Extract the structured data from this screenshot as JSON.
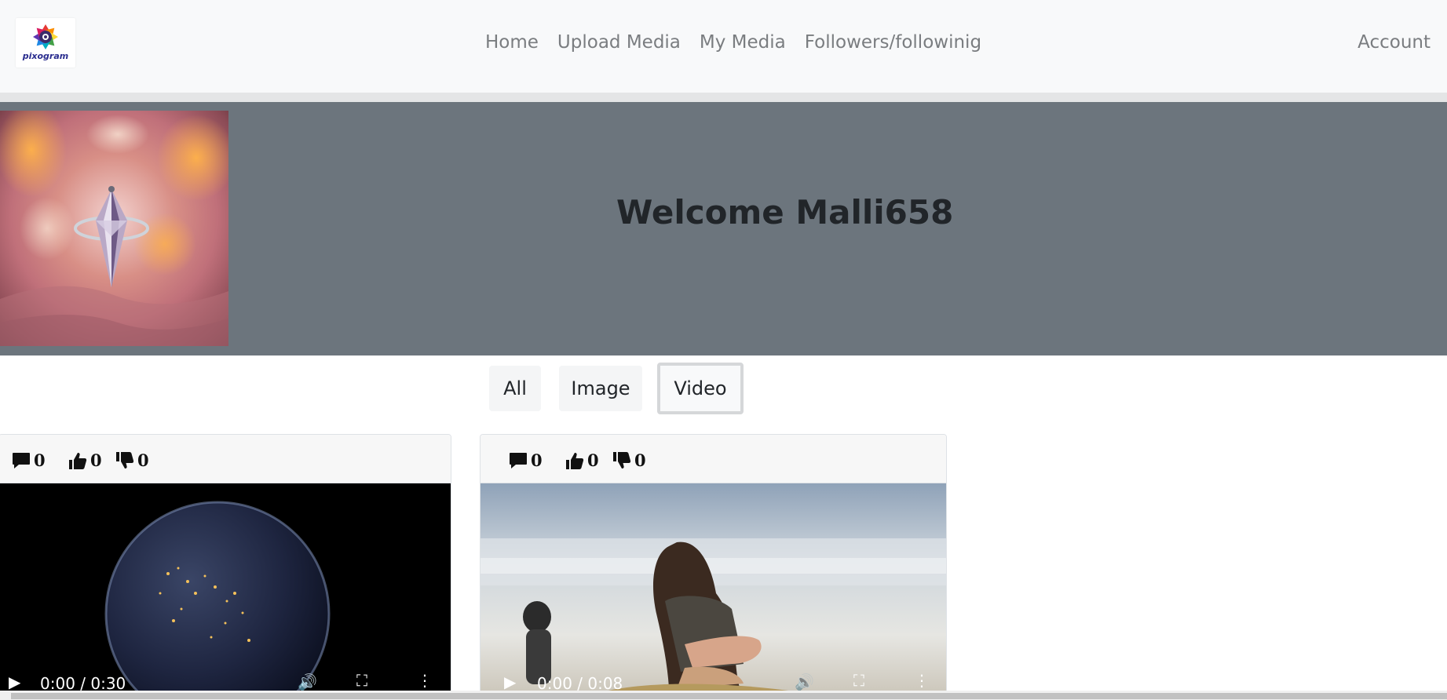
{
  "nav": {
    "logo_text": "pixogram",
    "links": [
      "Home",
      "Upload Media",
      "My Media",
      "Followers/followinig"
    ],
    "account": "Account"
  },
  "banner": {
    "welcome": "Welcome Malli658"
  },
  "filters": {
    "all": "All",
    "image": "Image",
    "video": "Video",
    "active": "Video"
  },
  "cards": [
    {
      "comments": "0",
      "likes": "0",
      "dislikes": "0",
      "time": "0:00 / 0:30"
    },
    {
      "comments": "0",
      "likes": "0",
      "dislikes": "0",
      "time": "0:00 / 0:08"
    }
  ]
}
